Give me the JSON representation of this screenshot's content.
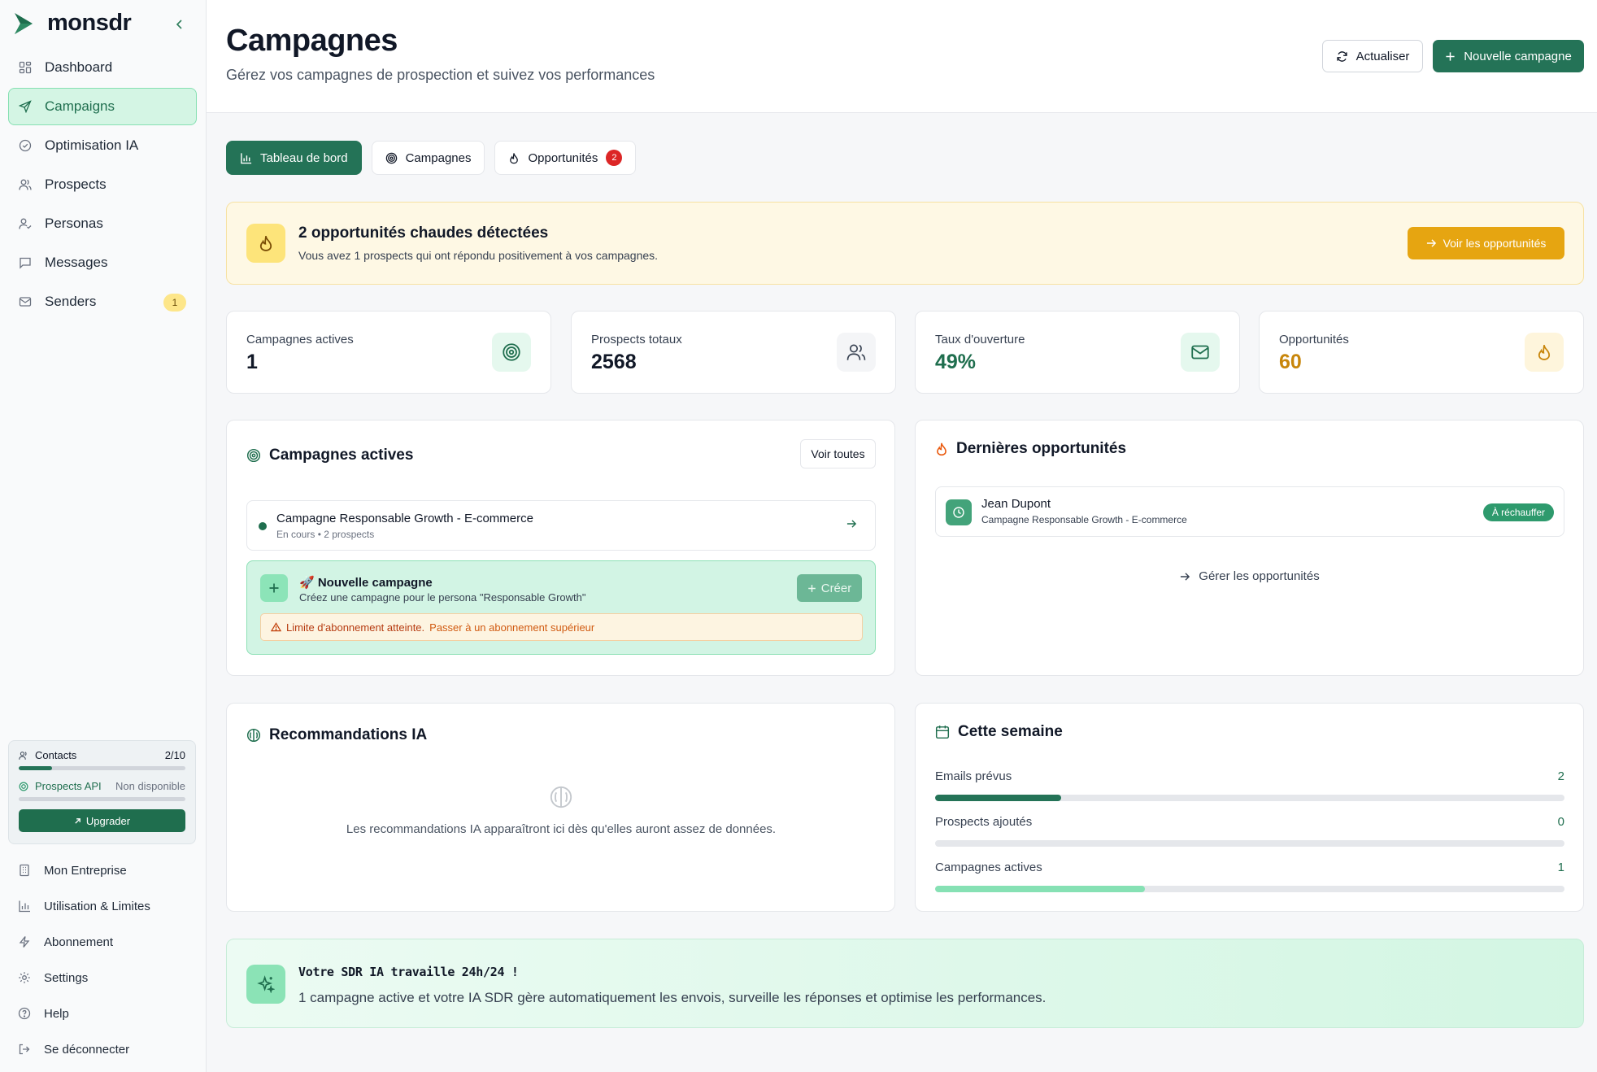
{
  "app": {
    "name": "monsdr"
  },
  "sidebar": {
    "items": [
      {
        "label": "Dashboard",
        "icon": "dashboard-icon"
      },
      {
        "label": "Campaigns",
        "icon": "send-icon",
        "active": true
      },
      {
        "label": "Optimisation IA",
        "icon": "check-circle-icon"
      },
      {
        "label": "Prospects",
        "icon": "users-icon"
      },
      {
        "label": "Personas",
        "icon": "user-check-icon"
      },
      {
        "label": "Messages",
        "icon": "message-icon"
      },
      {
        "label": "Senders",
        "icon": "mail-icon",
        "badge": "1"
      }
    ],
    "usage": {
      "contacts_label": "Contacts",
      "contacts_value": "2/10",
      "contacts_fraction": 0.2,
      "api_label": "Prospects API",
      "api_value": "Non disponible",
      "upgrade_label": "Upgrader"
    },
    "bottom": [
      {
        "label": "Mon Entreprise",
        "icon": "building-icon"
      },
      {
        "label": "Utilisation & Limites",
        "icon": "bar-chart-icon"
      },
      {
        "label": "Abonnement",
        "icon": "zap-icon"
      },
      {
        "label": "Settings",
        "icon": "gear-icon"
      },
      {
        "label": "Help",
        "icon": "help-circle-icon"
      },
      {
        "label": "Se déconnecter",
        "icon": "logout-icon"
      }
    ]
  },
  "header": {
    "title": "Campagnes",
    "subtitle": "Gérez vos campagnes de prospection et suivez vos performances",
    "refresh_label": "Actualiser",
    "new_label": "Nouvelle campagne"
  },
  "tabs": [
    {
      "label": "Tableau de bord",
      "active": true
    },
    {
      "label": "Campagnes"
    },
    {
      "label": "Opportunités",
      "count": "2"
    }
  ],
  "alert": {
    "title": "2 opportunités chaudes détectées",
    "text": "Vous avez 1 prospects qui ont répondu positivement à vos campagnes.",
    "button": "Voir les opportunités"
  },
  "stats": [
    {
      "label": "Campagnes actives",
      "value": "1",
      "color": "#111827"
    },
    {
      "label": "Prospects totaux",
      "value": "2568",
      "color": "#111827"
    },
    {
      "label": "Taux d'ouverture",
      "value": "49%",
      "color": "#1f6e4e"
    },
    {
      "label": "Opportunités",
      "value": "60",
      "color": "#c8860b"
    }
  ],
  "active_campaigns": {
    "title": "Campagnes actives",
    "see_all": "Voir toutes",
    "campaign": {
      "name": "Campagne Responsable Growth - E-commerce",
      "meta": "En cours • 2 prospects"
    },
    "new_campaign": {
      "title": "🚀 Nouvelle campagne",
      "subtitle": "Créez une campagne pour le persona \"Responsable Growth\"",
      "create": "Créer",
      "limit_text": "Limite d'abonnement atteinte.",
      "limit_link": "Passer à un abonnement supérieur"
    }
  },
  "opportunities": {
    "title": "Dernières opportunités",
    "item": {
      "name": "Jean Dupont",
      "campaign": "Campagne Responsable Growth - E-commerce",
      "badge": "À réchauffer"
    },
    "manage": "Gérer les opportunités"
  },
  "recommendations": {
    "title": "Recommandations IA",
    "empty": "Les recommandations IA apparaîtront ici dès qu'elles auront assez de données."
  },
  "week": {
    "title": "Cette semaine",
    "rows": [
      {
        "label": "Emails prévus",
        "value": "2",
        "fraction": 0.2,
        "color": "#247357"
      },
      {
        "label": "Prospects ajoutés",
        "value": "0",
        "fraction": 0,
        "color": "#247357"
      },
      {
        "label": "Campagnes actives",
        "value": "1",
        "fraction": 0.333,
        "color": "#86e1b4"
      }
    ]
  },
  "banner": {
    "title": "Votre SDR IA travaille 24h/24 !",
    "text": "1 campagne active et votre IA SDR gère automatiquement les envois, surveille les réponses et optimise les performances."
  }
}
